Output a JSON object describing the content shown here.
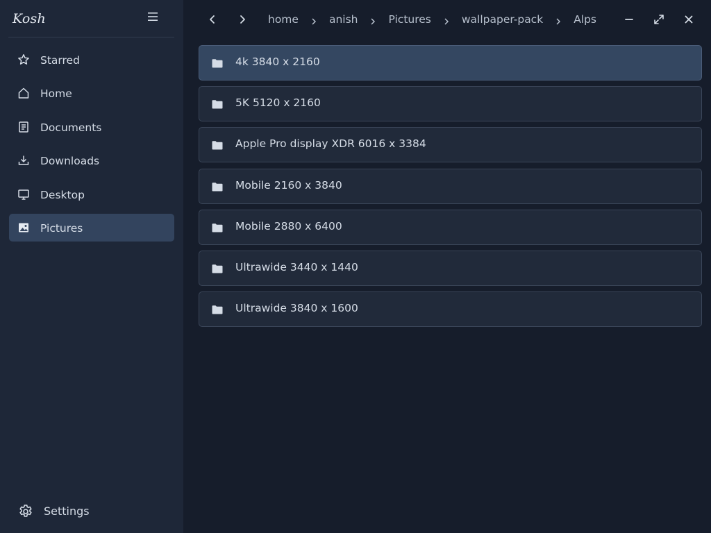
{
  "app": {
    "title": "Kosh"
  },
  "sidebar": {
    "items": [
      {
        "label": "Starred",
        "icon": "star-icon"
      },
      {
        "label": "Home",
        "icon": "home-icon"
      },
      {
        "label": "Documents",
        "icon": "document-icon"
      },
      {
        "label": "Downloads",
        "icon": "download-icon"
      },
      {
        "label": "Desktop",
        "icon": "monitor-icon"
      },
      {
        "label": "Pictures",
        "icon": "image-icon",
        "active": true
      }
    ],
    "settings": {
      "label": "Settings",
      "icon": "gear-icon"
    }
  },
  "breadcrumb": [
    "home",
    "anish",
    "Pictures",
    "wallpaper-pack",
    "Alps"
  ],
  "folders": [
    {
      "name": "4k 3840 x 2160",
      "selected": true
    },
    {
      "name": "5K 5120 x 2160"
    },
    {
      "name": "Apple Pro display XDR 6016 x 3384"
    },
    {
      "name": "Mobile 2160 x 3840"
    },
    {
      "name": "Mobile 2880 x 6400"
    },
    {
      "name": "Ultrawide 3440 x 1440"
    },
    {
      "name": "Ultrawide 3840 x 1600"
    }
  ],
  "colors": {
    "sidebar_bg": "#1e2738",
    "main_bg": "#161d2b",
    "active_item": "#33445e",
    "row_bg": "#212a3a",
    "row_selected": "#344761"
  }
}
